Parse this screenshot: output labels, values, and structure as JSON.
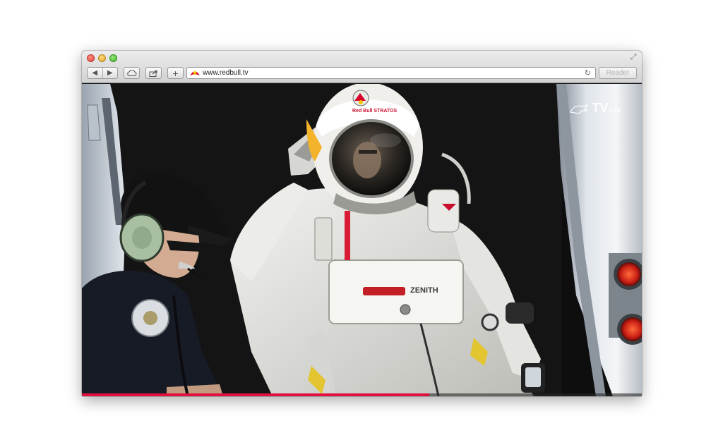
{
  "browser": {
    "url": "www.redbull.tv",
    "reader_label": "Reader",
    "nav_back_glyph": "◀",
    "nav_forward_glyph": "▶",
    "plus_glyph": "+",
    "reload_glyph": "↻",
    "fullscreen_glyph": "⤢"
  },
  "video": {
    "overlay_logo": "TV",
    "overlay_logo_live": "LIVE",
    "helmet_text": "Red Bull STRATOS",
    "chest_brand": "ZENITH",
    "progress_fraction": 0.62,
    "progress_color": "#e2103f"
  },
  "icons": [
    "back-icon",
    "forward-icon",
    "icloud-icon",
    "share-icon",
    "add-tab-icon",
    "reload-icon",
    "fullscreen-icon",
    "redbull-favicon"
  ]
}
